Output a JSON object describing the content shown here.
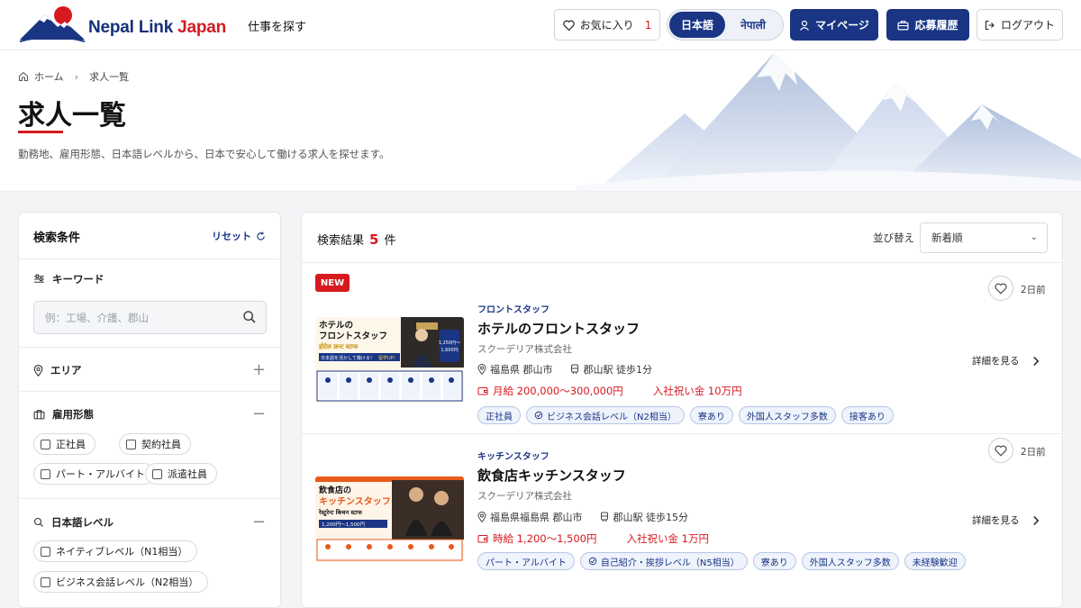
{
  "header": {
    "logo": {
      "brand": "Nepal Link",
      "brand_accent": "Japan"
    },
    "nav_jobs": "仕事を探す",
    "favorites": {
      "label": "お気に入り",
      "count": "1"
    },
    "language": {
      "ja": "日本語",
      "ne": "नेपाली",
      "active": "ja"
    },
    "mypage": "マイページ",
    "applications": "応募履歴",
    "logout": "ログアウト"
  },
  "hero": {
    "breadcrumb": {
      "home": "ホーム",
      "current": "求人一覧"
    },
    "title": "求人一覧",
    "subtitle": "勤務地、雇用形態、日本語レベルから、日本で安心して働ける求人を探せます。"
  },
  "sidebar": {
    "title": "検索条件",
    "reset": "リセット",
    "keyword": {
      "label": "キーワード",
      "placeholder": "例：工場、介護、郡山"
    },
    "area": {
      "label": "エリア"
    },
    "employment": {
      "label": "雇用形態",
      "options": [
        "正社員",
        "契約社員",
        "パート・アルバイト",
        "派遣社員"
      ]
    },
    "japanese_level": {
      "label": "日本語レベル",
      "options": [
        "ネイティブレベル（N1相当）",
        "ビジネス会話レベル（N2相当）"
      ]
    }
  },
  "results": {
    "label": "検索結果",
    "count": "5",
    "unit": "件",
    "sort_label": "並び替え",
    "sort_value": "新着順",
    "jobs": [
      {
        "badge": "NEW",
        "category": "フロントスタッフ",
        "title": "ホテルのフロントスタッフ",
        "company": "スクーデリア株式会社",
        "location": "福島県 郡山市",
        "station": "郡山駅 徒歩1分",
        "salary": "月給 200,000〜300,000円",
        "bonus": "入社祝い金 10万円",
        "tags": [
          "正社員",
          "ビジネス会話レベル（N2相当）",
          "寮あり",
          "外国人スタッフ多数",
          "接客あり"
        ],
        "posted": "2日前",
        "detail": "詳細を見る",
        "thumb": {
          "title1": "ホテルの",
          "title2": "フロントスタッフ",
          "nepali": "होटेल फ्रन्ट स्टाफ",
          "sub": "日本語を活かして働ける！",
          "sub2": "留学UP！",
          "salary1": "1,250円〜",
          "salary2": "1,600円"
        }
      },
      {
        "category": "キッチンスタッフ",
        "title": "飲食店キッチンスタッフ",
        "company": "スクーデリア株式会社",
        "location": "福島県福島県 郡山市",
        "station": "郡山駅 徒歩15分",
        "salary": "時給 1,200〜1,500円",
        "bonus": "入社祝い金 1万円",
        "tags": [
          "パート・アルバイト",
          "自己紹介・挨拶レベル（N5相当）",
          "寮あり",
          "外国人スタッフ多数",
          "未経験歓迎"
        ],
        "posted": "2日前",
        "detail": "詳細を見る",
        "thumb": {
          "title1": "飲食店の",
          "title2": "キッチンスタッフ",
          "nepali": "रेस्टुरेन्ट किचन स्टाफ",
          "salary1": "1,200円〜1,500円"
        }
      }
    ]
  },
  "colors": {
    "navy": "#1a3584",
    "red": "#d71920"
  }
}
